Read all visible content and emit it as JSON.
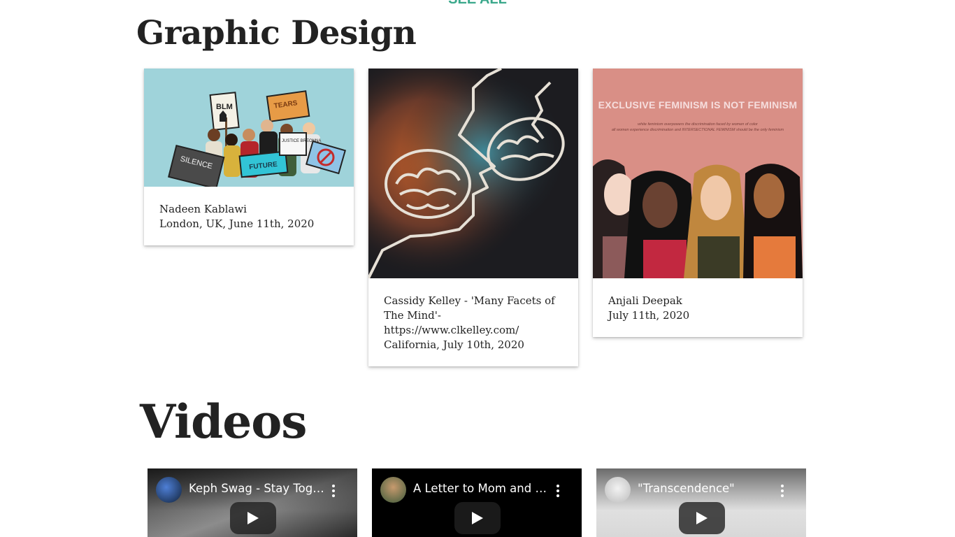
{
  "header": {
    "see_all": "SEE ALL"
  },
  "graphic_design": {
    "title": "Graphic Design",
    "cards": [
      {
        "lines": [
          "Nadeen Kablawi",
          "London, UK, June 11th, 2020"
        ]
      },
      {
        "lines": [
          "Cassidy Kelley - 'Many Facets of The Mind'-",
          "https://www.clkelley.com/",
          "California, July 10th, 2020"
        ]
      },
      {
        "lines": [
          "Anjali Deepak",
          "July 11th, 2020"
        ]
      }
    ],
    "poster_1": {
      "signs": [
        "BLM",
        "TEARS",
        "SILENCE",
        "JUSTICE BREONNA",
        "FUTURE"
      ]
    },
    "poster_3": {
      "headline": "EXCLUSIVE FEMINISM IS NOT FEMINISM",
      "sub_1": "white feminism overpowers the discrimination faced by women of color",
      "sub_2": "all women experience discrimination and INTERSECTIONAL FEMINISM should be the only feminism"
    }
  },
  "videos": {
    "title": "Videos",
    "items": [
      {
        "title": "Keph Swag - Stay Together"
      },
      {
        "title": "A Letter to Mom and Dad"
      },
      {
        "title": "\"Transcendence\""
      }
    ]
  },
  "colors": {
    "accent": "#3aa88b",
    "poster_1_bg": "#9fd3da",
    "poster_3_bg": "#d98f86"
  }
}
